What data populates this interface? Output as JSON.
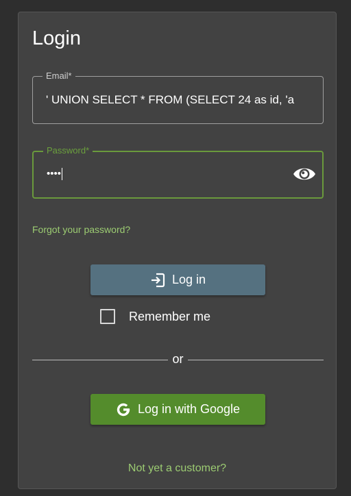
{
  "login_form": {
    "title": "Login",
    "email": {
      "label": "Email*",
      "value": "' UNION SELECT * FROM (SELECT 24 as id, 'a"
    },
    "password": {
      "label": "Password*",
      "masked_value": "••••",
      "visibility_toggle_icon": "eye-icon"
    },
    "forgot_password_link": "Forgot your password?",
    "login_button": {
      "label": "Log in",
      "icon": "login-icon",
      "color": "#557180"
    },
    "remember_me": {
      "label": "Remember me",
      "checked": false
    },
    "divider_text": "or",
    "google_button": {
      "label": "Log in with Google",
      "icon": "google-icon",
      "color": "#548c2c"
    },
    "signup_link": "Not yet a customer?"
  },
  "colors": {
    "background": "#2e2e2e",
    "card": "#424242",
    "accent_green": "#6ba03d",
    "link_green": "#9ccc72"
  }
}
